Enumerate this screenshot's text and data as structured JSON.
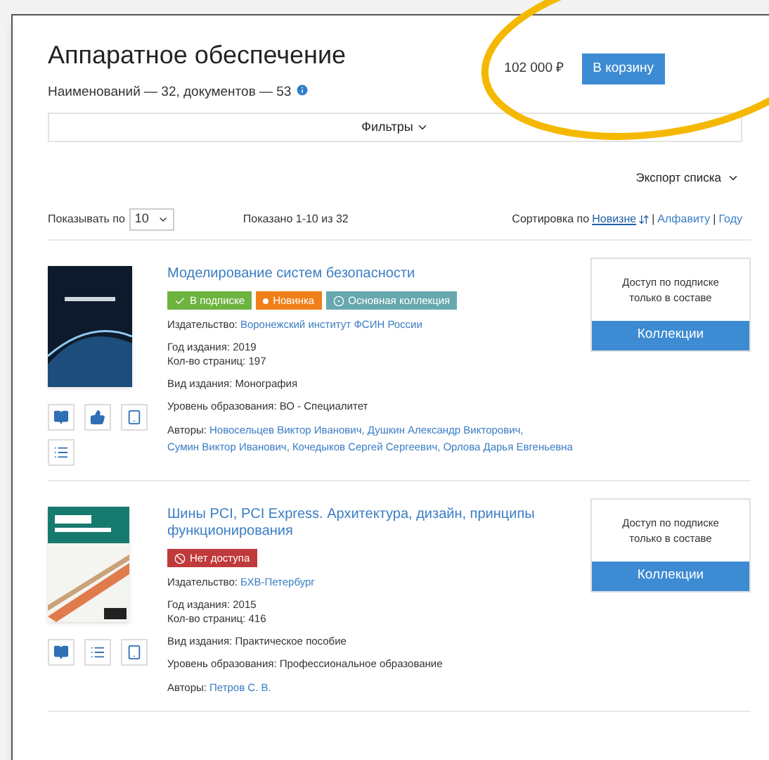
{
  "header": {
    "title": "Аппаратное обеспечение",
    "stats": "Наименований — 32, документов — 53",
    "price": "102 000 ₽",
    "cart_button": "В корзину"
  },
  "filters": {
    "label": "Фильтры"
  },
  "export": {
    "label": "Экспорт списка"
  },
  "list_controls": {
    "page_size_label": "Показывать по",
    "page_size": "10",
    "shown": "Показано 1-10 из 32",
    "sort_label": "Сортировка по",
    "separator": "|",
    "sort_options": [
      {
        "label": "Новизне",
        "selected": true
      },
      {
        "label": "Алфавиту",
        "selected": false
      },
      {
        "label": "Году",
        "selected": false
      }
    ]
  },
  "books": [
    {
      "cover": {
        "kind": "dark"
      },
      "title": "Моделирование систем безопасности",
      "tags": [
        {
          "kind": "subscription",
          "label": "В подписке"
        },
        {
          "kind": "new",
          "label": "Новинка"
        },
        {
          "kind": "collection",
          "label": "Основная коллекция"
        }
      ],
      "publisher_label": "Издательство:",
      "publisher": "Воронежский институт ФСИН России",
      "year": "Год издания: 2019",
      "pages": "Кол-во страниц: 197",
      "type": "Вид издания: Монография",
      "level": "Уровень образования: ВО - Специалитет",
      "authors_label": "Авторы:",
      "authors": [
        "Новосельцев Виктор Иванович,",
        "Душкин Александр Викторович,",
        "Сумин Виктор Иванович,",
        "Кочедыков Сергей Сергеевич,",
        "Орлова Дарья Евгеньевна"
      ],
      "actions": [
        {
          "kind": "read"
        },
        {
          "kind": "like"
        },
        {
          "kind": "device"
        },
        {
          "kind": "contents"
        }
      ],
      "access_text": "Доступ по подписке только в составе",
      "access_button": "Коллекции"
    },
    {
      "cover": {
        "kind": "light"
      },
      "title": "Шины PCI, PCI Express. Архитектура, дизайн, принципы функционирования",
      "tags": [
        {
          "kind": "no_access",
          "label": "Нет доступа"
        }
      ],
      "publisher_label": "Издательство:",
      "publisher": "БХВ-Петербург",
      "year": "Год издания: 2015",
      "pages": "Кол-во страниц: 416",
      "type": "Вид издания: Практическое пособие",
      "level": "Уровень образования: Профессиональное образование",
      "authors_label": "Авторы:",
      "authors": [
        "Петров С. В."
      ],
      "actions": [
        {
          "kind": "read"
        },
        {
          "kind": "contents"
        },
        {
          "kind": "device"
        }
      ],
      "access_text": "Доступ по подписке только в составе",
      "access_button": "Коллекции"
    }
  ]
}
